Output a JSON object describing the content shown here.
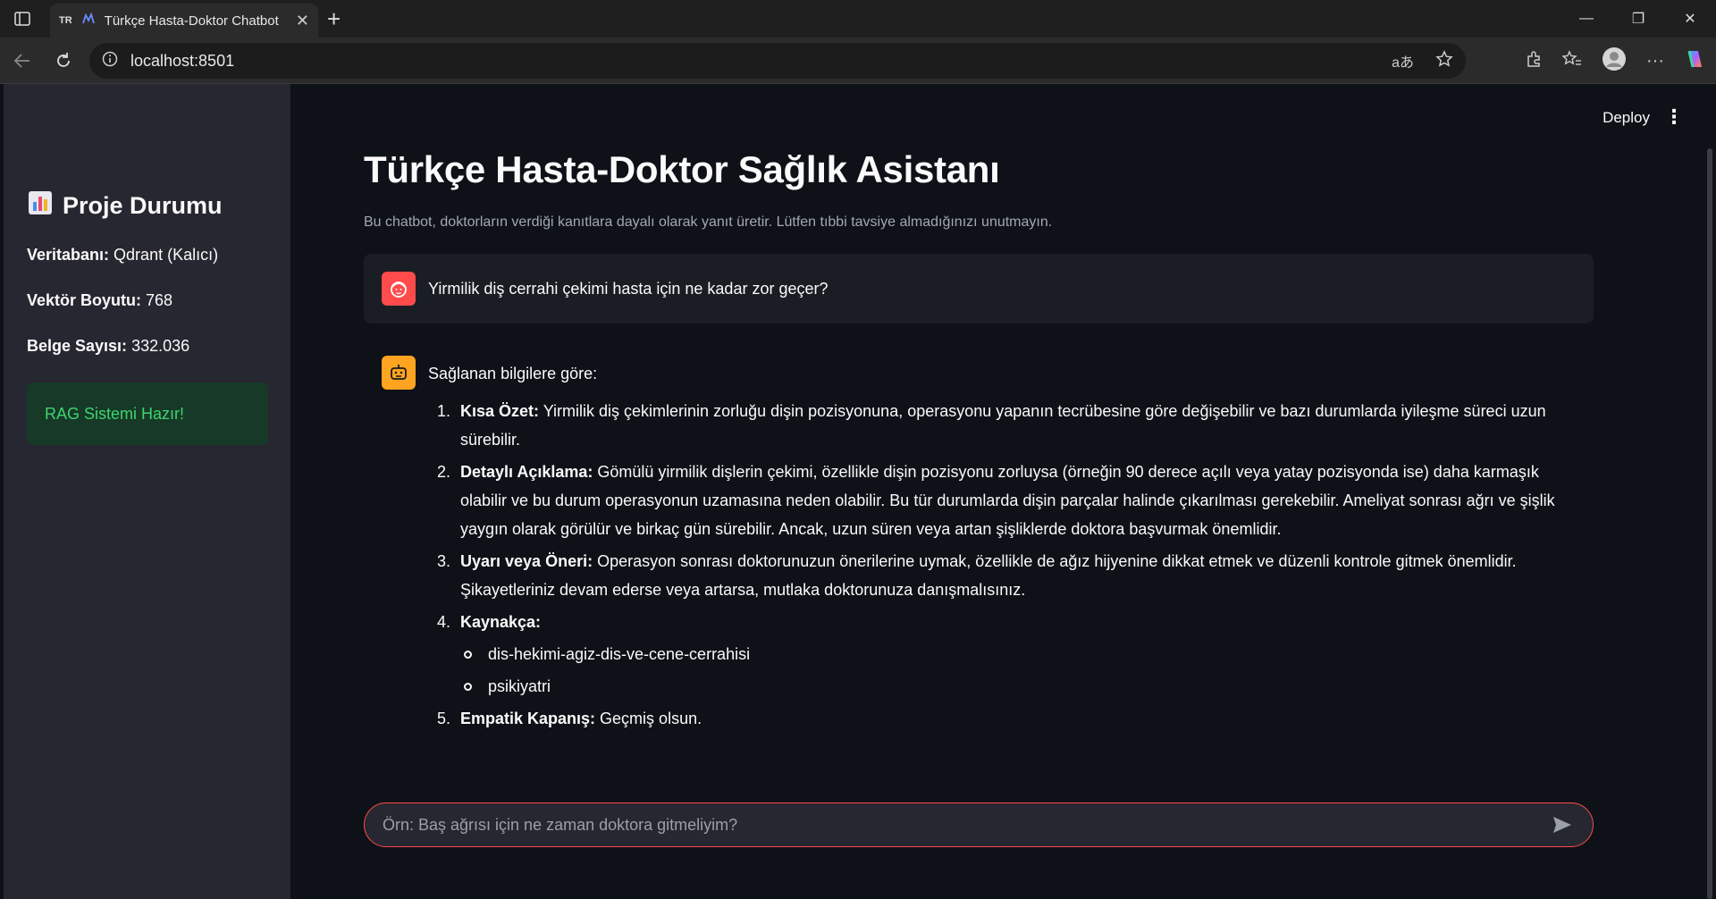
{
  "browser": {
    "tab_favicon_text": "TR",
    "tab_title": "Türkçe Hasta-Doktor Chatbot",
    "url": "localhost:8501"
  },
  "sidebar": {
    "title": "Proje Durumu",
    "title_icon": "bar-chart-icon",
    "rows": [
      {
        "label": "Veritabanı:",
        "value": "Qdrant (Kalıcı)"
      },
      {
        "label": "Vektör Boyutu:",
        "value": "768"
      },
      {
        "label": "Belge Sayısı:",
        "value": "332.036"
      }
    ],
    "status": "RAG Sistemi Hazır!"
  },
  "header": {
    "deploy_label": "Deploy"
  },
  "main": {
    "title": "Türkçe Hasta-Doktor Sağlık Asistanı",
    "caption": "Bu chatbot, doktorların verdiği kanıtlara dayalı olarak yanıt üretir. Lütfen tıbbi tavsiye almadığınızı unutmayın.",
    "user_message": "Yirmilik diş cerrahi çekimi hasta için ne kadar zor geçer?",
    "bot": {
      "intro": "Sağlanan bilgilere göre:",
      "items": [
        {
          "label": "Kısa Özet:",
          "text": " Yirmilik diş çekimlerinin zorluğu dişin pozisyonuna, operasyonu yapanın tecrübesine göre değişebilir ve bazı durumlarda iyileşme süreci uzun sürebilir."
        },
        {
          "label": "Detaylı Açıklama:",
          "text": " Gömülü yirmilik dişlerin çekimi, özellikle dişin pozisyonu zorluysa (örneğin 90 derece açılı veya yatay pozisyonda ise) daha karmaşık olabilir ve bu durum operasyonun uzamasına neden olabilir. Bu tür durumlarda dişin parçalar halinde çıkarılması gerekebilir. Ameliyat sonrası ağrı ve şişlik yaygın olarak görülür ve birkaç gün sürebilir. Ancak, uzun süren veya artan şişliklerde doktora başvurmak önemlidir."
        },
        {
          "label": "Uyarı veya Öneri:",
          "text": " Operasyon sonrası doktorunuzun önerilerine uymak, özellikle de ağız hijyenine dikkat etmek ve düzenli kontrole gitmek önemlidir. Şikayetleriniz devam ederse veya artarsa, mutlaka doktorunuza danışmalısınız."
        },
        {
          "label": "Kaynakça:",
          "text": ""
        },
        {
          "label": "Empatik Kapanış:",
          "text": " Geçmiş olsun."
        }
      ],
      "sources": [
        "dis-hekimi-agiz-dis-ve-cene-cerrahisi",
        "psikiyatri"
      ]
    },
    "input_placeholder": "Örn: Baş ağrısı için ne zaman doktora gitmeliyim?"
  }
}
